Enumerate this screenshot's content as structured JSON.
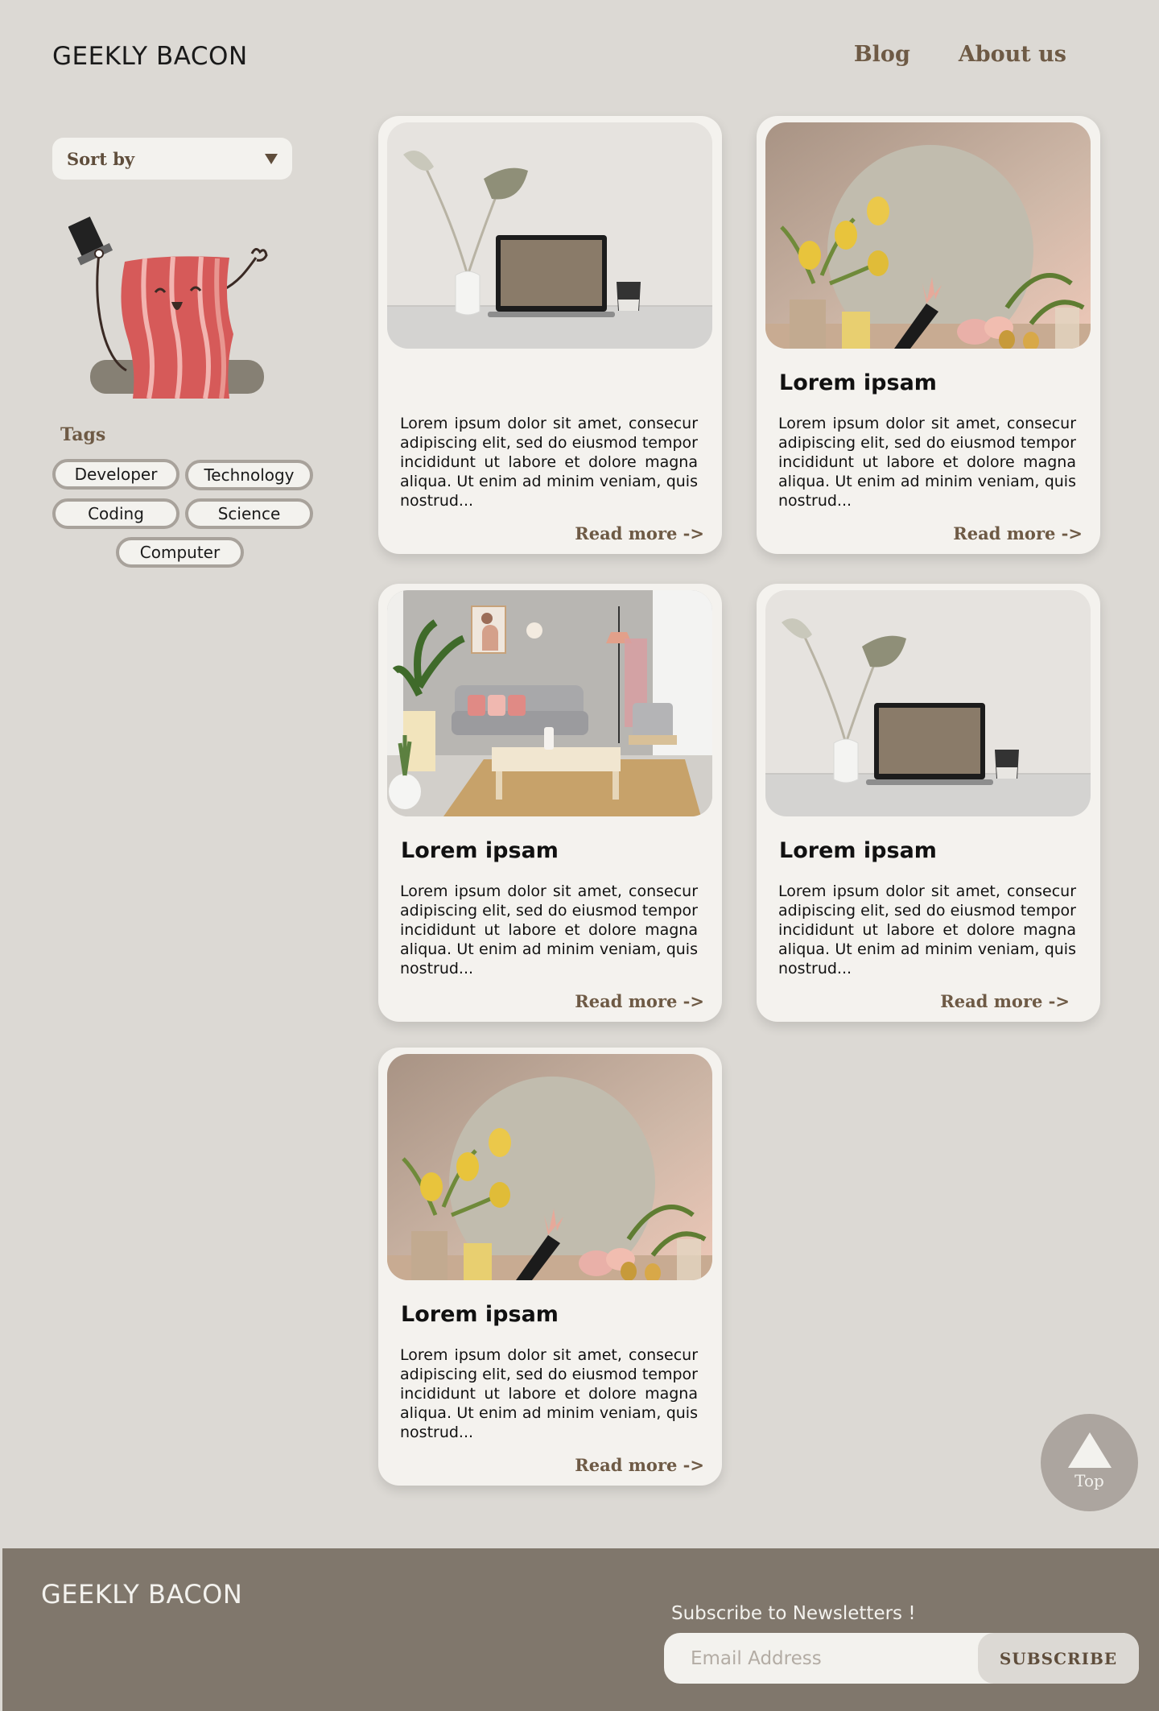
{
  "header": {
    "logo": "GEEKLY BACON",
    "nav": [
      {
        "label": "Blog"
      },
      {
        "label": "About us"
      }
    ]
  },
  "sidebar": {
    "sort_label": "Sort by",
    "tags_title": "Tags",
    "tags": [
      "Developer",
      "Technology",
      "Coding",
      "Science",
      "Computer"
    ]
  },
  "cards": [
    {
      "image": "laptop-desk-photo",
      "title": "",
      "body": "Lorem ipsum dolor sit amet, consecur adipiscing elit, sed do eiusmod tempor incididunt ut labore et dolore magna aliqua. Ut enim ad minim veniam, quis nostrud...",
      "link": "Read more ->"
    },
    {
      "image": "tulips-mirror-photo",
      "title": "Lorem ipsam",
      "body": "Lorem ipsum dolor sit amet, consecur adipiscing elit, sed do eiusmod tempor incididunt ut labore et dolore magna aliqua. Ut enim ad minim veniam, quis nostrud...",
      "link": "Read more ->"
    },
    {
      "image": "living-room-photo",
      "title": "Lorem ipsam",
      "body": "Lorem ipsum dolor sit amet, consecur adipiscing elit, sed do eiusmod tempor incididunt ut labore et dolore magna aliqua. Ut enim ad minim veniam, quis nostrud...",
      "link": "Read more ->"
    },
    {
      "image": "laptop-desk-photo",
      "title": "Lorem ipsam",
      "body": "Lorem ipsum dolor sit amet, consecur adipiscing elit, sed do eiusmod tempor incididunt ut labore et dolore magna aliqua. Ut enim ad minim veniam, quis nostrud...",
      "link": "Read more ->"
    },
    {
      "image": "tulips-mirror-photo",
      "title": "Lorem ipsam",
      "body": "Lorem ipsum dolor sit amet, consecur adipiscing elit, sed do eiusmod tempor incididunt ut labore et dolore magna aliqua. Ut enim ad minim veniam, quis nostrud...",
      "link": "Read more ->"
    }
  ],
  "top_button": {
    "label": "Top"
  },
  "footer": {
    "logo": "GEEKLY BACON",
    "newsletter_title": "Subscribe to Newsletters !",
    "email_placeholder": "Email Address",
    "subscribe_label": "SUBSCRIBE"
  },
  "colors": {
    "background": "#dcd9d4",
    "card": "#f4f2ee",
    "accent_brown": "#6e5a45",
    "footer": "#80776c"
  }
}
